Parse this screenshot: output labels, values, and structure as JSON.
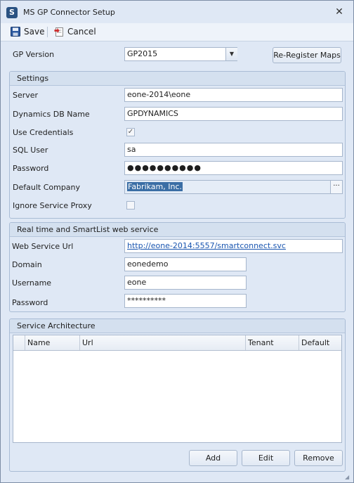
{
  "window": {
    "title": "MS GP Connector Setup"
  },
  "toolbar": {
    "save_label": "Save",
    "cancel_label": "Cancel"
  },
  "top": {
    "gp_version_label": "GP Version",
    "gp_version_value": "GP2015",
    "reregister_label": "Re-Register Maps"
  },
  "settings": {
    "title": "Settings",
    "server_label": "Server",
    "server_value": "eone-2014\\eone",
    "db_label": "Dynamics DB Name",
    "db_value": "GPDYNAMICS",
    "use_credentials_label": "Use Credentials",
    "use_credentials_checked": true,
    "sql_user_label": "SQL User",
    "sql_user_value": "sa",
    "password_label": "Password",
    "password_value": "●●●●●●●●●●",
    "default_company_label": "Default Company",
    "default_company_value": "Fabrikam, Inc.",
    "ellipsis": "···",
    "ignore_proxy_label": "Ignore Service Proxy",
    "ignore_proxy_checked": false
  },
  "webservice": {
    "title": "Real time and SmartList web service",
    "url_label": "Web Service Url",
    "url_value": "http://eone-2014:5557/smartconnect.svc",
    "domain_label": "Domain",
    "domain_value": "eonedemo",
    "username_label": "Username",
    "username_value": "eone",
    "password_label": "Password",
    "password_value": "**********"
  },
  "architecture": {
    "title": "Service Architecture",
    "columns": [
      "Name",
      "Url",
      "Tenant",
      "Default"
    ],
    "add_label": "Add",
    "edit_label": "Edit",
    "remove_label": "Remove"
  }
}
